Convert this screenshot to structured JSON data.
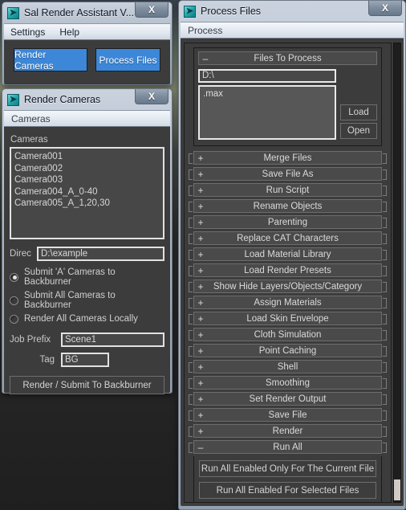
{
  "main_window": {
    "title": "Sal Render Assistant V...",
    "icon": "app-arrow-icon",
    "close_label": "X",
    "menu": [
      {
        "label": "Settings"
      },
      {
        "label": "Help"
      }
    ],
    "buttons": [
      {
        "label": "Render Cameras"
      },
      {
        "label": "Process Files"
      }
    ],
    "accent_color": "#3c87d8"
  },
  "render_cameras_window": {
    "title": "Render Cameras",
    "icon": "app-arrow-icon",
    "close_label": "X",
    "tab_label": "Cameras",
    "list_label": "Cameras",
    "camera_list": [
      "Camera001",
      "Camera002",
      "Camera003",
      "Camera004_A_0-40",
      "Camera005_A_1,20,30"
    ],
    "directory": {
      "label": "Direc",
      "value": "D:\\example"
    },
    "radio_options": [
      {
        "label": "Submit 'A' Cameras to Backburner",
        "selected": true
      },
      {
        "label": "Submit All Cameras to Backburner",
        "selected": false
      },
      {
        "label": "Render All Cameras Locally",
        "selected": false
      }
    ],
    "job_prefix": {
      "label": "Job Prefix",
      "value": "Scene1"
    },
    "tag": {
      "label": "Tag",
      "value": "BG"
    },
    "submit_button": "Render / Submit To Backburner"
  },
  "process_files_window": {
    "title": "Process Files",
    "icon": "app-arrow-icon",
    "close_label": "X",
    "tab_label": "Process",
    "files_to_process": {
      "header": "Files To Process",
      "state": "expanded",
      "toggle_glyph": "–",
      "path_value": "D:\\",
      "file_list": [
        ".max"
      ],
      "load_button": "Load",
      "open_button": "Open"
    },
    "rollouts": [
      {
        "label": "Merge Files",
        "glyph": "+",
        "expanded": false
      },
      {
        "label": "Save File As",
        "glyph": "+",
        "expanded": false
      },
      {
        "label": "Run Script",
        "glyph": "+",
        "expanded": false
      },
      {
        "label": "Rename Objects",
        "glyph": "+",
        "expanded": false
      },
      {
        "label": "Parenting",
        "glyph": "+",
        "expanded": false
      },
      {
        "label": "Replace CAT Characters",
        "glyph": "+",
        "expanded": false
      },
      {
        "label": "Load Material Library",
        "glyph": "+",
        "expanded": false
      },
      {
        "label": "Load Render Presets",
        "glyph": "+",
        "expanded": false
      },
      {
        "label": "Show Hide Layers/Objects/Category",
        "glyph": "+",
        "expanded": false
      },
      {
        "label": "Assign Materials",
        "glyph": "+",
        "expanded": false
      },
      {
        "label": "Load Skin Envelope",
        "glyph": "+",
        "expanded": false
      },
      {
        "label": "Cloth Simulation",
        "glyph": "+",
        "expanded": false
      },
      {
        "label": "Point Caching",
        "glyph": "+",
        "expanded": false
      },
      {
        "label": "Shell",
        "glyph": "+",
        "expanded": false
      },
      {
        "label": "Smoothing",
        "glyph": "+",
        "expanded": false
      },
      {
        "label": "Set Render Output",
        "glyph": "+",
        "expanded": false
      },
      {
        "label": "Save File",
        "glyph": "+",
        "expanded": false
      },
      {
        "label": "Render",
        "glyph": "+",
        "expanded": false
      }
    ],
    "run_all": {
      "header": "Run All",
      "glyph": "–",
      "expanded": true,
      "buttons": [
        "Run All Enabled Only For The Current File",
        "Run All Enabled For Selected Files"
      ]
    }
  }
}
